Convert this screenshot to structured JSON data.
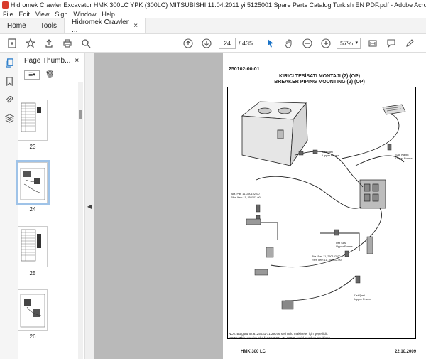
{
  "window": {
    "title": "Hidromek Crawler Excavator HMK 300LC YPK (300LC) MITSUBISHI 11.04.2011 yi 5125001 Spare Parts Catalog Turkish EN PDF.pdf - Adobe Acrobat Pro DC (32-bit)"
  },
  "menu": [
    "File",
    "Edit",
    "View",
    "Sign",
    "Window",
    "Help"
  ],
  "tabs": {
    "home": "Home",
    "tools": "Tools",
    "doc": "Hidromek Crawler ...",
    "close": "×"
  },
  "toolbar": {
    "page_current": "24",
    "page_sep_total": "/ 435",
    "zoom": "57%"
  },
  "thumbs": {
    "panel_title": "Page Thumb...",
    "close": "×",
    "pages": [
      "23",
      "24",
      "25",
      "26"
    ]
  },
  "document": {
    "code": "250102-00-01",
    "title_tr": "KIRICI TESİSATI MONTAJI (2) (OP)",
    "title_en": "BREAKER PIPING MOUNTING (2) (OP)",
    "note_tr": "NOT: Bu görünüt 6125031-71 29076 seri nolu makineler için geçerlidir.",
    "note_en": "NOTE: This view is valid for 6125031-71 29076 serial number machines.",
    "footer_model": "HMK 300 LC",
    "footer_date": "22.10.2009",
    "labels": {
      "ust_sasi_1": "Üst Şasi",
      "upper_frame_1": "Upper Frame",
      "ust_sasi_2": "Üst Şasi",
      "upper_frame_2": "Upper Frame",
      "ust_sasi_3": "Üst Şasi",
      "upper_frame_3": "Upper Frame",
      "sag_kabin": "Sağ Kabin",
      "right_cabin": "Upper Frame",
      "bkz1": "Bkz. Par. 11, 250102-00",
      "bkz2": "Rfer. Item 11, 250102-00",
      "bkz3": "Bkz. Par. 11, 250102-00",
      "bkz4": "Rfer. Item 11, 250102-00"
    }
  },
  "colors": {
    "accent": "#1a73c7",
    "viewer_bg": "#b9b9b9",
    "selection": "#9fc3e8",
    "app_icon": "#d83b2c"
  }
}
